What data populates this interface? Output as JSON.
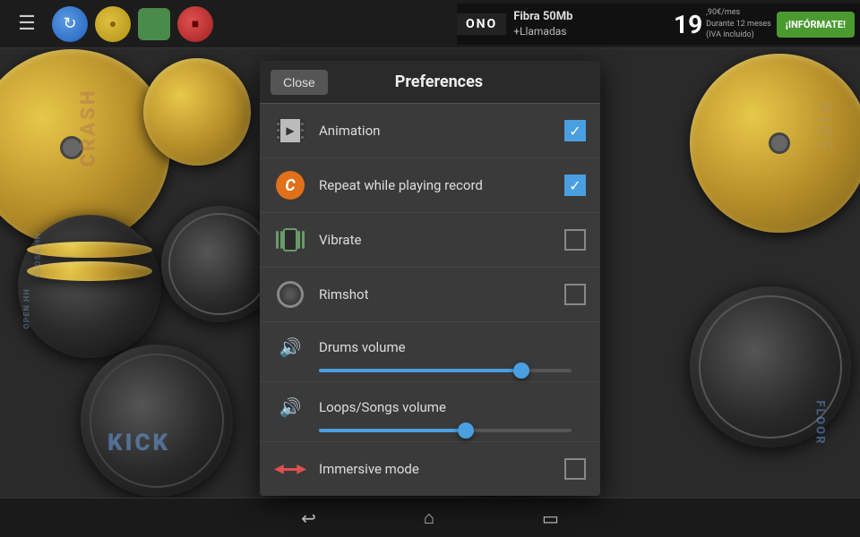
{
  "toolbar": {
    "menu_icon": "☰",
    "buttons": [
      "menu",
      "refresh",
      "record",
      "green",
      "red"
    ]
  },
  "ad": {
    "brand": "ONO",
    "line1": "Fibra 50Mb",
    "line2": "+Llamadas",
    "price": "19",
    "decimal": ",90€/mes",
    "sub1": "Durante 12 meses",
    "sub2": "(IVA incluido)",
    "cta": "¡INFÓRMATE!"
  },
  "preferences": {
    "title": "Preferences",
    "close_label": "Close",
    "items": [
      {
        "id": "animation",
        "label": "Animation",
        "type": "checkbox",
        "checked": true
      },
      {
        "id": "repeat",
        "label": "Repeat while playing record",
        "type": "checkbox",
        "checked": true
      },
      {
        "id": "vibrate",
        "label": "Vibrate",
        "type": "checkbox",
        "checked": false
      },
      {
        "id": "rimshot",
        "label": "Rimshot",
        "type": "checkbox",
        "checked": false
      },
      {
        "id": "drums-volume",
        "label": "Drums volume",
        "type": "slider",
        "value": 80
      },
      {
        "id": "loops-volume",
        "label": "Loops/Songs volume",
        "type": "slider",
        "value": 58
      },
      {
        "id": "immersive",
        "label": "Immersive mode",
        "type": "checkbox",
        "checked": false
      }
    ]
  },
  "drum_labels": {
    "crash": "CRASH",
    "ride": "RIDE",
    "close_hh": "CLOSE HH",
    "open_hh": "OPEN HH",
    "kick1": "KICK",
    "kick2": "KICK",
    "floor": "FLOOR"
  },
  "bottom_nav": {
    "back": "←",
    "home": "⌂",
    "recent": "▭"
  }
}
